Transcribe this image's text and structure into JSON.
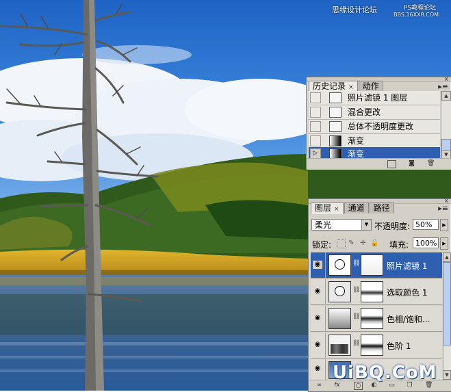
{
  "watermark": {
    "top_text": "思缘设计论坛",
    "top_right": "PS教程论坛",
    "url": "BBS.16XX8.COM",
    "bottom": "UiBQ.CoM"
  },
  "history_panel": {
    "tabs": [
      {
        "label": "历史记录",
        "active": true
      },
      {
        "label": "动作",
        "active": false
      }
    ],
    "close_glyph": "×",
    "items": [
      {
        "label": "照片滤镜 1 图层",
        "icon": "document-icon",
        "selected": false
      },
      {
        "label": "混合更改",
        "icon": "document-icon",
        "selected": false
      },
      {
        "label": "总体不透明度更改",
        "icon": "document-icon",
        "selected": false
      },
      {
        "label": "渐变",
        "icon": "gradient-icon",
        "selected": false
      },
      {
        "label": "渐变",
        "icon": "gradient-icon",
        "selected": true
      }
    ]
  },
  "layers_panel": {
    "tabs": [
      {
        "label": "图层",
        "active": true
      },
      {
        "label": "通道",
        "active": false
      },
      {
        "label": "路径",
        "active": false
      }
    ],
    "blend_mode": "柔光",
    "opacity_label": "不透明度:",
    "opacity_value": "50%",
    "lock_label": "锁定:",
    "fill_label": "填充:",
    "fill_value": "100%",
    "layers": [
      {
        "name": "照片滤镜 1",
        "selected": true
      },
      {
        "name": "选取颜色 1",
        "selected": false
      },
      {
        "name": "色相/饱和...",
        "selected": false
      },
      {
        "name": "色阶 1",
        "selected": false
      },
      {
        "name": "",
        "selected": false
      }
    ],
    "footer_icons": [
      "link-icon",
      "fx-icon",
      "mask-icon",
      "adjustment-icon",
      "folder-icon",
      "new-layer-icon",
      "trash-icon"
    ]
  },
  "colors": {
    "selection": "#2e5fb0",
    "panel_bg": "#d4d0c8"
  }
}
